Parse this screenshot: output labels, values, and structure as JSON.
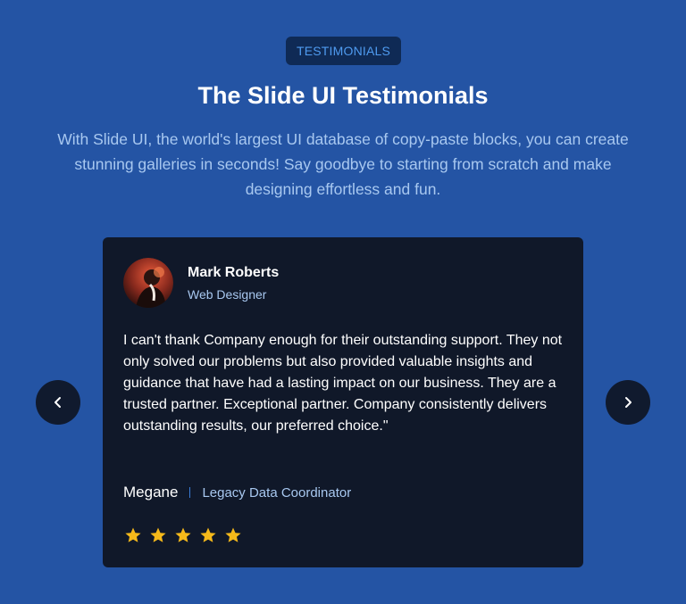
{
  "section": {
    "badge": "TESTIMONIALS",
    "title": "The Slide UI Testimonials",
    "subtitle": "With Slide UI, the world's largest UI database of copy-paste blocks, you can create stunning galleries in seconds! Say goodbye to starting from scratch and make designing effortless and fun."
  },
  "carousel": {
    "prev_icon": "chevron-left-icon",
    "next_icon": "chevron-right-icon"
  },
  "testimonial": {
    "name": "Mark Roberts",
    "role": "Web Designer",
    "quote": "I can't thank Company enough for their outstanding support. They not only solved our problems but also provided valuable insights and guidance that have had a lasting impact on our business. They are a trusted partner. Exceptional partner. Company consistently delivers outstanding results, our preferred choice.\"",
    "author_name": "Megane",
    "author_title": "Legacy Data Coordinator",
    "rating": 5
  },
  "colors": {
    "background": "#2454a4",
    "card": "#101829",
    "accent": "#4f9bf0",
    "star": "#f5b91a"
  }
}
